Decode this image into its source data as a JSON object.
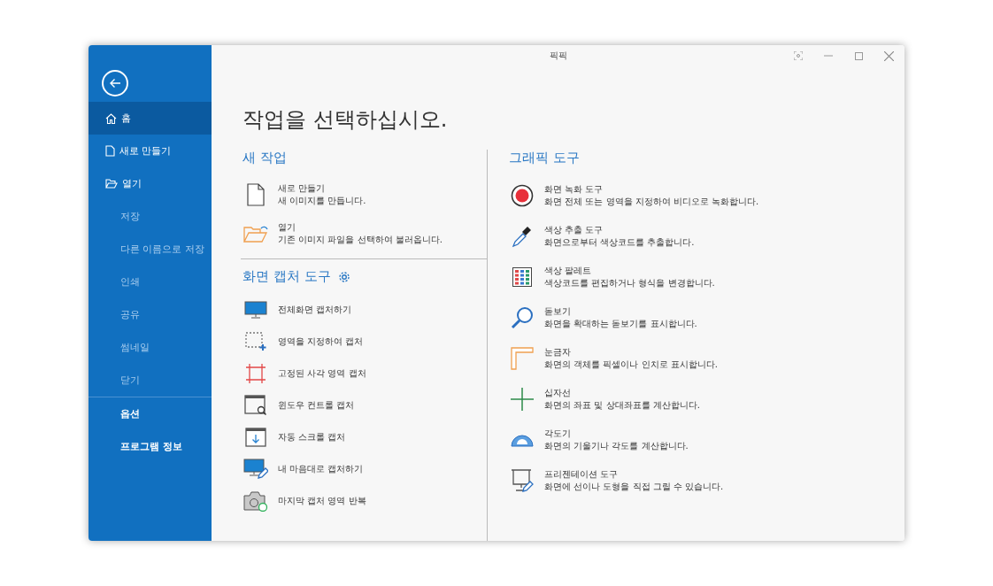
{
  "window": {
    "title": "픽픽"
  },
  "sidebar": {
    "items": [
      {
        "label": "홈",
        "kind": "home",
        "selected": true,
        "disabled": false
      },
      {
        "label": "새로 만들기",
        "kind": "file",
        "selected": false,
        "disabled": false
      },
      {
        "label": "열기",
        "kind": "folder",
        "selected": false,
        "disabled": false
      },
      {
        "label": "저장",
        "kind": "plain",
        "selected": false,
        "disabled": true
      },
      {
        "label": "다른 이름으로 저장",
        "kind": "plain",
        "selected": false,
        "disabled": true
      },
      {
        "label": "인쇄",
        "kind": "plain",
        "selected": false,
        "disabled": true
      },
      {
        "label": "공유",
        "kind": "plain",
        "selected": false,
        "disabled": true
      },
      {
        "label": "썸네일",
        "kind": "plain",
        "selected": false,
        "disabled": true
      },
      {
        "label": "닫기",
        "kind": "plain",
        "selected": false,
        "disabled": true
      }
    ],
    "footer_items": [
      {
        "label": "옵션",
        "selected": false,
        "disabled": false
      },
      {
        "label": "프로그램 정보",
        "selected": false,
        "disabled": false
      }
    ]
  },
  "heading": "작업을 선택하십시오.",
  "new_task": {
    "title": "새 작업",
    "items": [
      {
        "kind": "new",
        "title": "새로 만들기",
        "description": "새 이미지를 만듭니다."
      },
      {
        "kind": "open",
        "title": "열기",
        "description": "기존 이미지 파일을 선택하여 불러옵니다."
      }
    ]
  },
  "capture": {
    "title": "화면 캡처 도구",
    "items": [
      {
        "kind": "fullscreen",
        "label": "전체화면 캡처하기"
      },
      {
        "kind": "region",
        "label": "영역을 지정하여 캡처"
      },
      {
        "kind": "fixed",
        "label": "고정된 사각 영역 캡처"
      },
      {
        "kind": "window",
        "label": "윈도우 컨트롤 캡처"
      },
      {
        "kind": "scroll",
        "label": "자동 스크롤 캡처"
      },
      {
        "kind": "freehand",
        "label": "내 마음대로 캡처하기"
      },
      {
        "kind": "repeat",
        "label": "마지막 캡처 영역 반복"
      }
    ]
  },
  "graphic_tools": {
    "title": "그래픽 도구",
    "items": [
      {
        "kind": "record",
        "title": "화면 녹화 도구",
        "description": "화면 전체 또는 영역을 지정하여 비디오로 녹화합니다."
      },
      {
        "kind": "picker",
        "title": "색상 추출 도구",
        "description": "화면으로부터 색상코드를 추출합니다."
      },
      {
        "kind": "palette",
        "title": "색상 팔레트",
        "description": "색상코드를 편집하거나 형식을 변경합니다."
      },
      {
        "kind": "magnifier",
        "title": "돋보기",
        "description": "화면을 확대하는 돋보기를 표시합니다."
      },
      {
        "kind": "ruler",
        "title": "눈금자",
        "description": "화면의 객체를 픽셀이나 인치로 표시합니다."
      },
      {
        "kind": "crosshair",
        "title": "십자선",
        "description": "화면의 좌표 및 상대좌표를 계산합니다."
      },
      {
        "kind": "protractor",
        "title": "각도기",
        "description": "화면의 기울기나 각도를 계산합니다."
      },
      {
        "kind": "whiteboard",
        "title": "프리젠테이션 도구",
        "description": "화면에 선이나 도형을 직접 그릴 수 있습니다."
      }
    ]
  }
}
